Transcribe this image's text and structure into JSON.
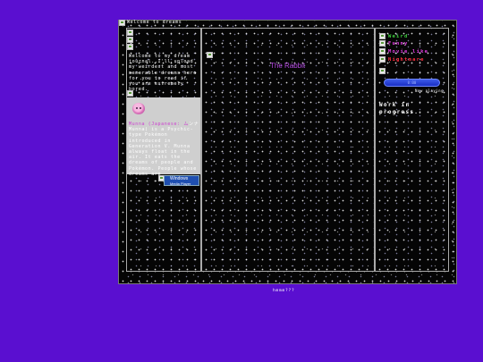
{
  "page": {
    "title_image_alt": "Welcome to dreams"
  },
  "left": {
    "intro_text": "Welcome to my dream journal. I'll upload my weirdest and most memorable dreams here for you to read if you are extremely bored.",
    "munna_name": "Munna (Japanese: ム",
    "munna_text": "ンナ Munna) is a Psychic-type Pokémon introduced in Generation V. Munna always float in the air. It eats the dreams of people and Pokémon. People whose dreams are",
    "wmp_line1": "Windows",
    "wmp_line2": "Media Player"
  },
  "center": {
    "heading": "The Rabbit"
  },
  "right": {
    "nav": [
      {
        "label": "Weird",
        "color": "#3fcf3f",
        "icon": "broken-image-icon"
      },
      {
        "label": "Funny",
        "color": "#e03fe0",
        "icon": "broken-image-icon"
      },
      {
        "label": "Movie like",
        "color": "#e03fe0",
        "icon": "broken-image-icon"
      },
      {
        "label": "Nightmare",
        "color": "#ff3040",
        "icon": "broken-image-icon"
      }
    ],
    "player_label": "0:00",
    "now_playing": "Now playing",
    "wip": "Work in\nprogress."
  },
  "footer": {
    "text": "hmmm???"
  },
  "colors": {
    "page_bg": "#5a0fd0",
    "rabbit_purple": "#b448e0"
  }
}
